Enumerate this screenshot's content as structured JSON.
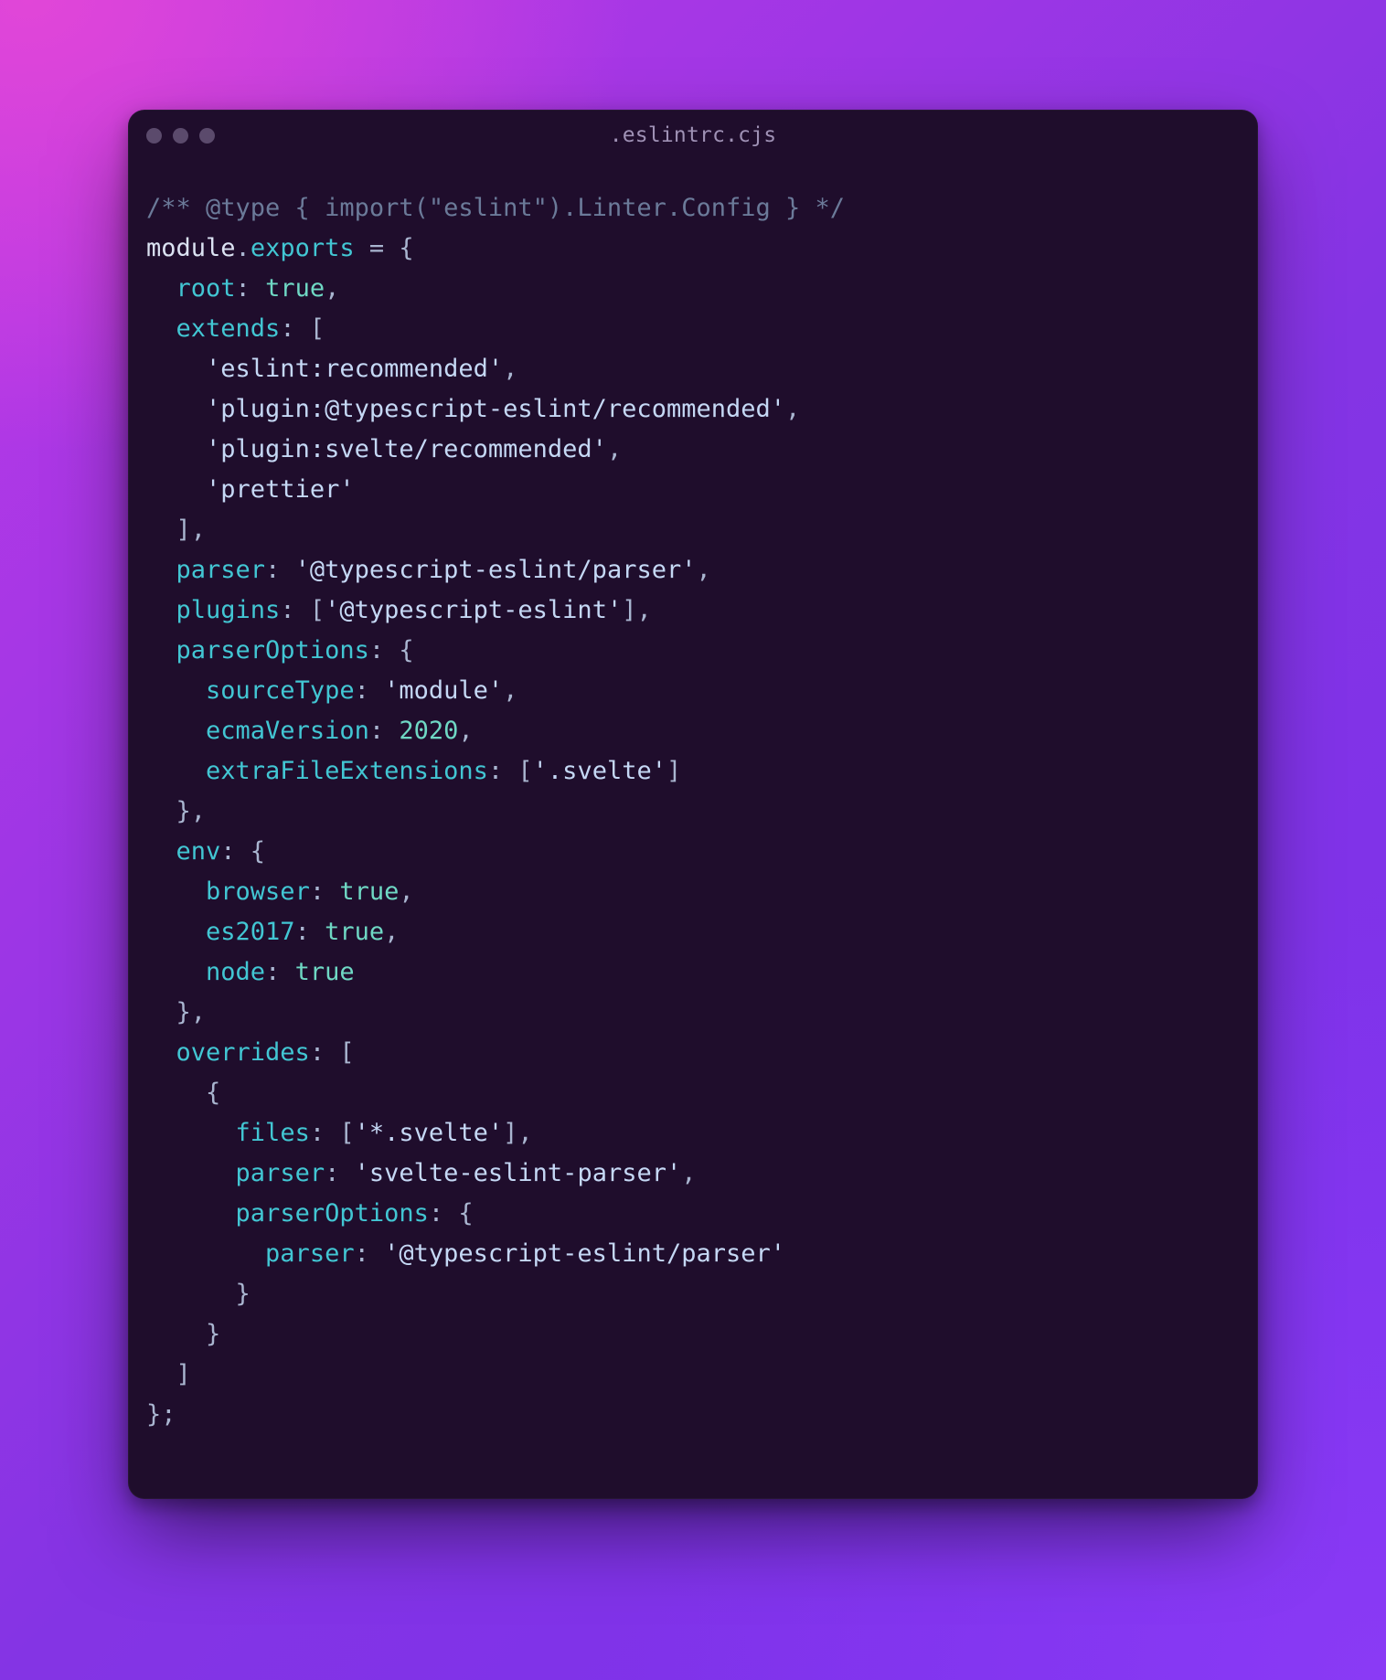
{
  "window": {
    "title": ".eslintrc.cjs"
  },
  "code": {
    "lines": [
      [
        {
          "t": "comment",
          "v": "/** @type { import(\"eslint\").Linter.Config } */"
        }
      ],
      [
        {
          "t": "default",
          "v": "module"
        },
        {
          "t": "punct",
          "v": "."
        },
        {
          "t": "property",
          "v": "exports"
        },
        {
          "t": "default",
          "v": " "
        },
        {
          "t": "punct",
          "v": "="
        },
        {
          "t": "default",
          "v": " "
        },
        {
          "t": "punct",
          "v": "{"
        }
      ],
      [
        {
          "t": "default",
          "v": "  "
        },
        {
          "t": "property",
          "v": "root"
        },
        {
          "t": "punct",
          "v": ": "
        },
        {
          "t": "boolean",
          "v": "true"
        },
        {
          "t": "punct",
          "v": ","
        }
      ],
      [
        {
          "t": "default",
          "v": "  "
        },
        {
          "t": "property",
          "v": "extends"
        },
        {
          "t": "punct",
          "v": ": ["
        }
      ],
      [
        {
          "t": "default",
          "v": "    "
        },
        {
          "t": "string",
          "v": "'eslint:recommended'"
        },
        {
          "t": "punct",
          "v": ","
        }
      ],
      [
        {
          "t": "default",
          "v": "    "
        },
        {
          "t": "string",
          "v": "'plugin:@typescript-eslint/recommended'"
        },
        {
          "t": "punct",
          "v": ","
        }
      ],
      [
        {
          "t": "default",
          "v": "    "
        },
        {
          "t": "string",
          "v": "'plugin:svelte/recommended'"
        },
        {
          "t": "punct",
          "v": ","
        }
      ],
      [
        {
          "t": "default",
          "v": "    "
        },
        {
          "t": "string",
          "v": "'prettier'"
        }
      ],
      [
        {
          "t": "default",
          "v": "  "
        },
        {
          "t": "punct",
          "v": "],"
        }
      ],
      [
        {
          "t": "default",
          "v": "  "
        },
        {
          "t": "property",
          "v": "parser"
        },
        {
          "t": "punct",
          "v": ": "
        },
        {
          "t": "string",
          "v": "'@typescript-eslint/parser'"
        },
        {
          "t": "punct",
          "v": ","
        }
      ],
      [
        {
          "t": "default",
          "v": "  "
        },
        {
          "t": "property",
          "v": "plugins"
        },
        {
          "t": "punct",
          "v": ": ["
        },
        {
          "t": "string",
          "v": "'@typescript-eslint'"
        },
        {
          "t": "punct",
          "v": "],"
        }
      ],
      [
        {
          "t": "default",
          "v": "  "
        },
        {
          "t": "property",
          "v": "parserOptions"
        },
        {
          "t": "punct",
          "v": ": {"
        }
      ],
      [
        {
          "t": "default",
          "v": "    "
        },
        {
          "t": "property",
          "v": "sourceType"
        },
        {
          "t": "punct",
          "v": ": "
        },
        {
          "t": "string",
          "v": "'module'"
        },
        {
          "t": "punct",
          "v": ","
        }
      ],
      [
        {
          "t": "default",
          "v": "    "
        },
        {
          "t": "property",
          "v": "ecmaVersion"
        },
        {
          "t": "punct",
          "v": ": "
        },
        {
          "t": "number",
          "v": "2020"
        },
        {
          "t": "punct",
          "v": ","
        }
      ],
      [
        {
          "t": "default",
          "v": "    "
        },
        {
          "t": "property",
          "v": "extraFileExtensions"
        },
        {
          "t": "punct",
          "v": ": ["
        },
        {
          "t": "string",
          "v": "'.svelte'"
        },
        {
          "t": "punct",
          "v": "]"
        }
      ],
      [
        {
          "t": "default",
          "v": "  "
        },
        {
          "t": "punct",
          "v": "},"
        }
      ],
      [
        {
          "t": "default",
          "v": "  "
        },
        {
          "t": "property",
          "v": "env"
        },
        {
          "t": "punct",
          "v": ": {"
        }
      ],
      [
        {
          "t": "default",
          "v": "    "
        },
        {
          "t": "property",
          "v": "browser"
        },
        {
          "t": "punct",
          "v": ": "
        },
        {
          "t": "boolean",
          "v": "true"
        },
        {
          "t": "punct",
          "v": ","
        }
      ],
      [
        {
          "t": "default",
          "v": "    "
        },
        {
          "t": "property",
          "v": "es2017"
        },
        {
          "t": "punct",
          "v": ": "
        },
        {
          "t": "boolean",
          "v": "true"
        },
        {
          "t": "punct",
          "v": ","
        }
      ],
      [
        {
          "t": "default",
          "v": "    "
        },
        {
          "t": "property",
          "v": "node"
        },
        {
          "t": "punct",
          "v": ": "
        },
        {
          "t": "boolean",
          "v": "true"
        }
      ],
      [
        {
          "t": "default",
          "v": "  "
        },
        {
          "t": "punct",
          "v": "},"
        }
      ],
      [
        {
          "t": "default",
          "v": "  "
        },
        {
          "t": "property",
          "v": "overrides"
        },
        {
          "t": "punct",
          "v": ": ["
        }
      ],
      [
        {
          "t": "default",
          "v": "    "
        },
        {
          "t": "punct",
          "v": "{"
        }
      ],
      [
        {
          "t": "default",
          "v": "      "
        },
        {
          "t": "property",
          "v": "files"
        },
        {
          "t": "punct",
          "v": ": ["
        },
        {
          "t": "string",
          "v": "'*.svelte'"
        },
        {
          "t": "punct",
          "v": "],"
        }
      ],
      [
        {
          "t": "default",
          "v": "      "
        },
        {
          "t": "property",
          "v": "parser"
        },
        {
          "t": "punct",
          "v": ": "
        },
        {
          "t": "string",
          "v": "'svelte-eslint-parser'"
        },
        {
          "t": "punct",
          "v": ","
        }
      ],
      [
        {
          "t": "default",
          "v": "      "
        },
        {
          "t": "property",
          "v": "parserOptions"
        },
        {
          "t": "punct",
          "v": ": {"
        }
      ],
      [
        {
          "t": "default",
          "v": "        "
        },
        {
          "t": "property",
          "v": "parser"
        },
        {
          "t": "punct",
          "v": ": "
        },
        {
          "t": "string",
          "v": "'@typescript-eslint/parser'"
        }
      ],
      [
        {
          "t": "default",
          "v": "      "
        },
        {
          "t": "punct",
          "v": "}"
        }
      ],
      [
        {
          "t": "default",
          "v": "    "
        },
        {
          "t": "punct",
          "v": "}"
        }
      ],
      [
        {
          "t": "default",
          "v": "  "
        },
        {
          "t": "punct",
          "v": "]"
        }
      ],
      [
        {
          "t": "punct",
          "v": "};"
        }
      ]
    ]
  }
}
